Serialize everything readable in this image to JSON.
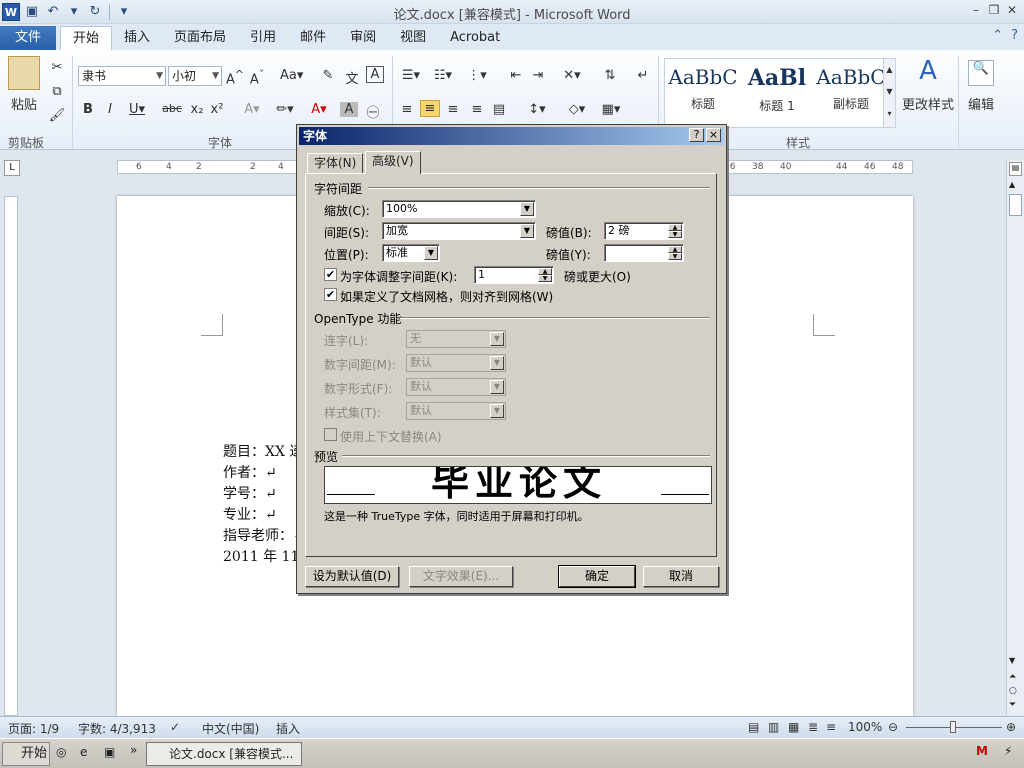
{
  "window": {
    "title": "论文.docx [兼容模式] - Microsoft Word",
    "app_icon": "W"
  },
  "qat": {
    "undo_icon": "↶",
    "redo_icon": "↻",
    "save_icon": "▣",
    "more_icon": "▾"
  },
  "ribbon_tabs": [
    "开始",
    "插入",
    "页面布局",
    "引用",
    "邮件",
    "审阅",
    "视图",
    "Acrobat"
  ],
  "file_tab": "文件",
  "active_tab": "开始",
  "ribbon": {
    "paste_label": "粘贴",
    "clipboard_group": "剪贴板",
    "font_group": "字体",
    "styles_group": "样式",
    "font_name": "隶书",
    "font_size": "小初",
    "styles": [
      {
        "sample": "AaBbC",
        "name": "标题"
      },
      {
        "sample": "AaBl",
        "name": "标题 1"
      },
      {
        "sample": "AaBbC",
        "name": "副标题"
      }
    ],
    "change_styles_label": "更改样式",
    "edit_label": "编辑"
  },
  "document": {
    "lines": [
      "题目：XX 递",
      "作者：↵",
      "学号：↵",
      "专业：↵",
      "指导老师：↵",
      "2011 年 11 月"
    ]
  },
  "ruler": {
    "ticks": [
      "6",
      "4",
      "2",
      "",
      "2",
      "4"
    ],
    "right_ticks": [
      "36",
      "38",
      "40",
      "",
      "44",
      "46",
      "48"
    ]
  },
  "status": {
    "page": "页面: 1/9",
    "words": "字数: 4/3,913",
    "language": "中文(中国)",
    "mode": "插入",
    "zoom": "100%"
  },
  "taskbar": {
    "start": "开始",
    "task": "论文.docx [兼容模式..."
  },
  "dialog": {
    "title": "字体",
    "help_btn": "?",
    "close_btn": "×",
    "tabs": [
      "字体(N)",
      "高级(V)"
    ],
    "active_tab": "高级(V)",
    "spacing_section": "字符间距",
    "scale_label": "缩放(C):",
    "scale_value": "100%",
    "spacing_label": "间距(S):",
    "spacing_value": "加宽",
    "spacing_by_label": "磅值(B):",
    "spacing_by_value": "2 磅",
    "position_label": "位置(P):",
    "position_value": "标准",
    "position_by_label": "磅值(Y):",
    "position_by_value": "",
    "kerning_label": "为字体调整字间距(K):",
    "kerning_checked": true,
    "kerning_value": "1",
    "kerning_suffix": "磅或更大(O)",
    "snap_grid_label": "如果定义了文档网格，则对齐到网格(W)",
    "snap_grid_checked": true,
    "opentype_section": "OpenType 功能",
    "ligatures_label": "连字(L):",
    "ligatures_value": "无",
    "num_spacing_label": "数字间距(M):",
    "num_spacing_value": "默认",
    "num_forms_label": "数字形式(F):",
    "num_forms_value": "默认",
    "stylistic_label": "样式集(T):",
    "stylistic_value": "默认",
    "contextual_label": "使用上下文替换(A)",
    "preview_section": "预览",
    "preview_text": "毕业论文",
    "preview_note": "这是一种 TrueType 字体，同时适用于屏幕和打印机。",
    "set_default_btn": "设为默认值(D)",
    "text_effects_btn": "文字效果(E)...",
    "ok_btn": "确定",
    "cancel_btn": "取消"
  }
}
